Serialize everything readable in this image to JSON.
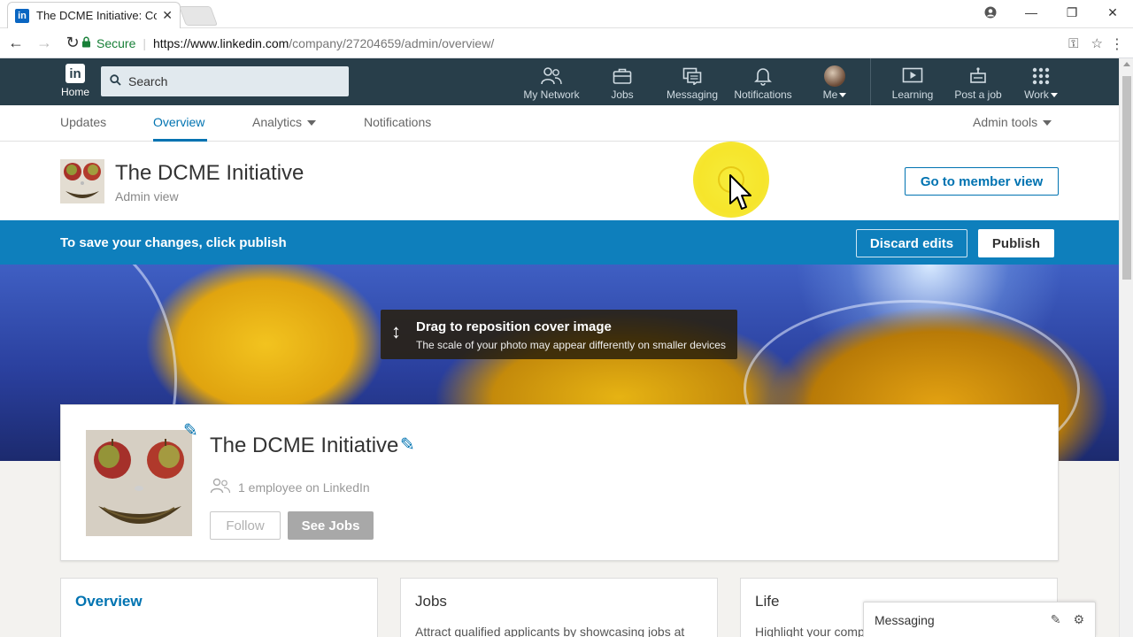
{
  "browser": {
    "tab_title": "The DCME Initiative: Cor",
    "secure_label": "Secure",
    "url_host": "https://www.linkedin.com",
    "url_path": "/company/27204659/admin/overview/"
  },
  "nav": {
    "home": "Home",
    "search_placeholder": "Search",
    "my_network": "My Network",
    "jobs": "Jobs",
    "messaging": "Messaging",
    "notifications": "Notifications",
    "me": "Me",
    "learning": "Learning",
    "post_job": "Post a job",
    "work": "Work"
  },
  "subnav": {
    "updates": "Updates",
    "overview": "Overview",
    "analytics": "Analytics",
    "notifications": "Notifications",
    "admin_tools": "Admin tools"
  },
  "company": {
    "name": "The DCME Initiative",
    "admin_view": "Admin view",
    "member_view_button": "Go to member view",
    "employees": "1 employee on LinkedIn",
    "follow": "Follow",
    "see_jobs": "See Jobs"
  },
  "publish_bar": {
    "message": "To save your changes, click publish",
    "discard": "Discard edits",
    "publish": "Publish"
  },
  "cover": {
    "tip_title": "Drag to reposition cover image",
    "tip_sub": "The scale of your photo may appear differently on smaller devices"
  },
  "cards": {
    "overview_title": "Overview",
    "jobs_title": "Jobs",
    "jobs_text": "Attract qualified applicants by showcasing jobs at",
    "life_title": "Life",
    "life_text": "Highlight your comp"
  },
  "messaging_widget": {
    "label": "Messaging"
  },
  "colors": {
    "nav_bg": "#283e4a",
    "brand_blue": "#0073b1",
    "publish_bar": "#0e7fbc"
  }
}
